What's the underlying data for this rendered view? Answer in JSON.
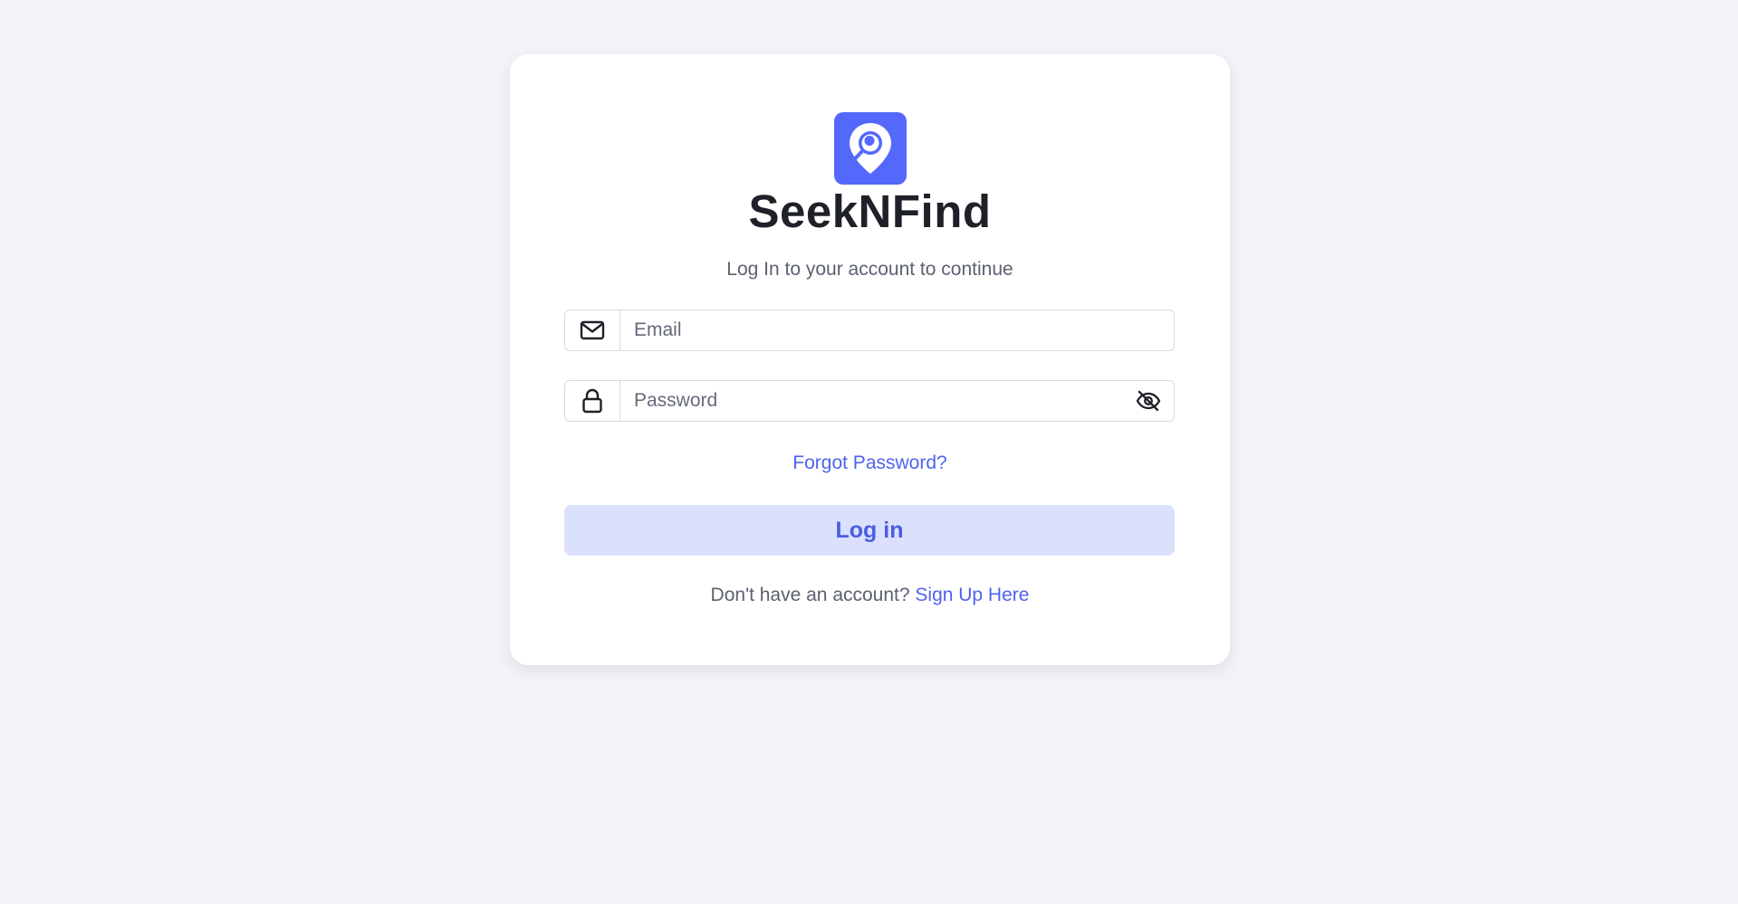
{
  "brand": {
    "name": "SeekNFind",
    "logo_icon": "location-pin-search-icon",
    "accent_color": "#5468fb"
  },
  "login": {
    "subtitle": "Log In to your account to continue",
    "email": {
      "placeholder": "Email",
      "value": "",
      "icon": "envelope-icon"
    },
    "password": {
      "placeholder": "Password",
      "value": "",
      "icon": "lock-icon",
      "toggle_icon": "eye-off-icon"
    },
    "forgot_label": "Forgot Password?",
    "submit_label": "Log in",
    "signup_prompt": "Don't have an account?",
    "signup_link": "Sign Up Here"
  }
}
